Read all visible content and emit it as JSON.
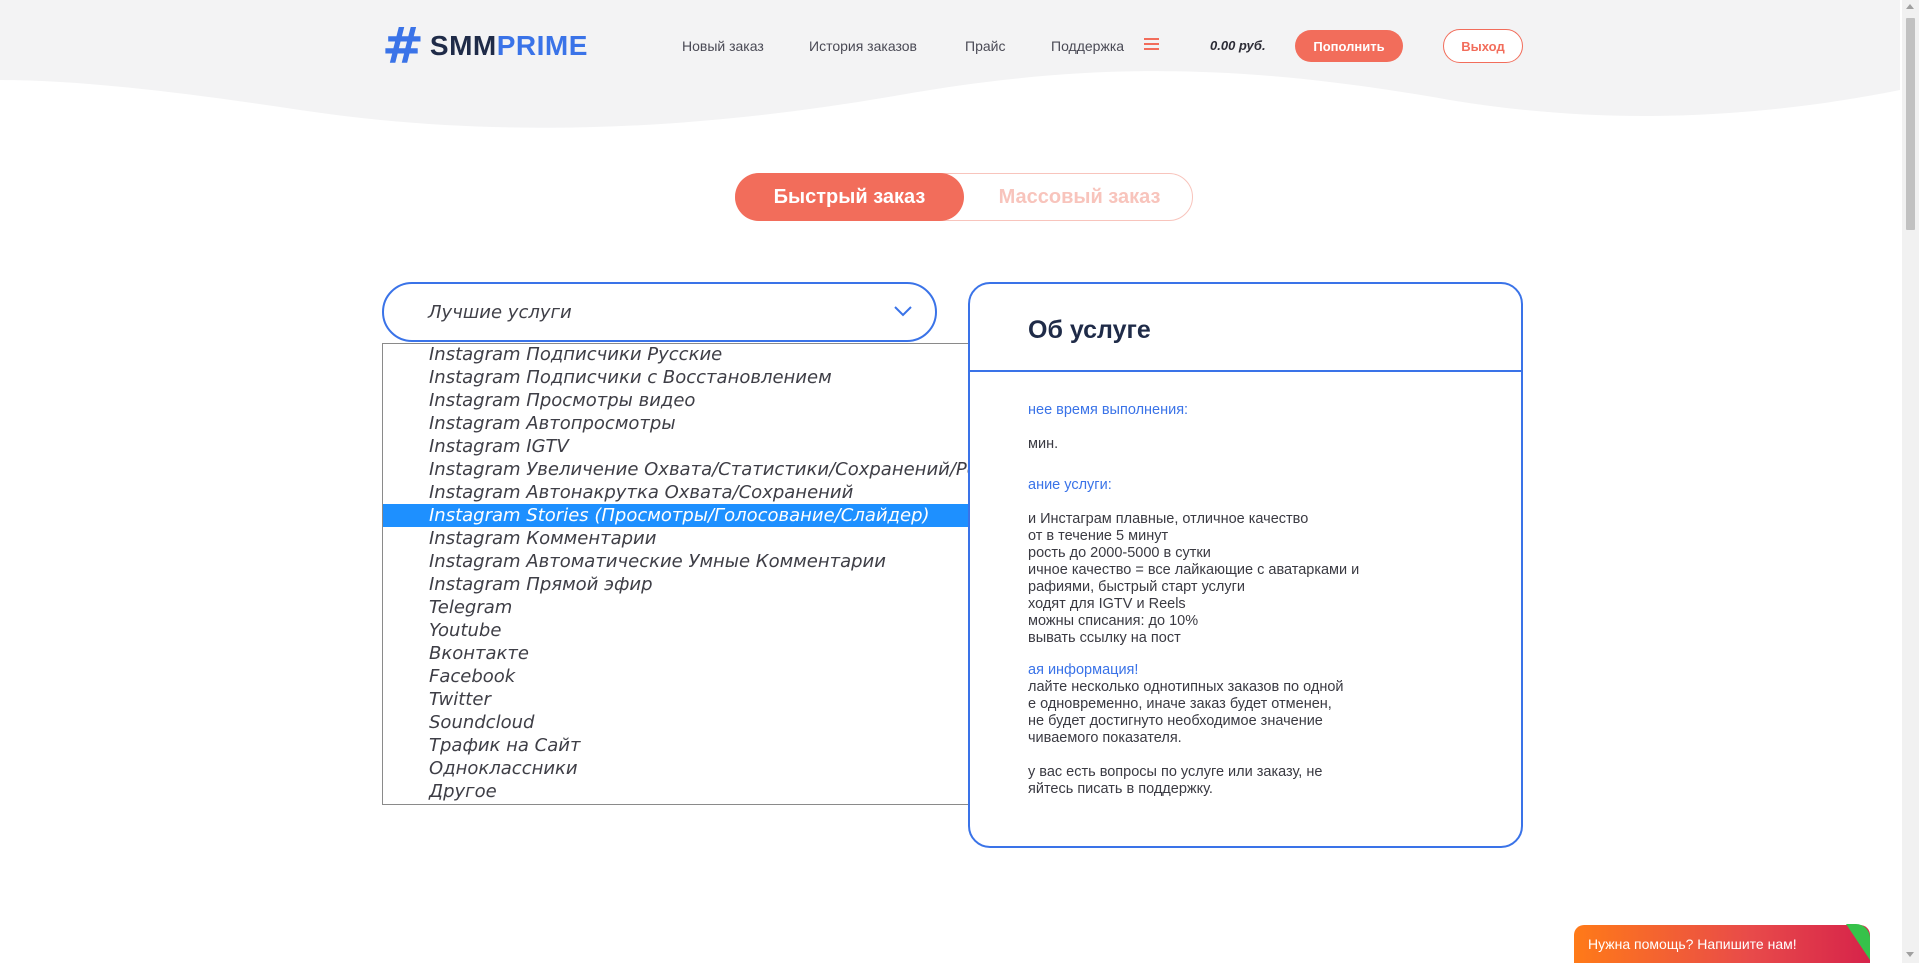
{
  "header": {
    "logo_smm": "SMM",
    "logo_prime": "PRIME",
    "nav": [
      "Новый заказ",
      "История заказов",
      "Прайс",
      "Поддержка"
    ],
    "balance": "0.00 руб.",
    "topup_label": "Пополнить",
    "exit_label": "Выход"
  },
  "tabs": {
    "quick": "Быстрый заказ",
    "mass": "Массовый заказ"
  },
  "select": {
    "value": "Лучшие услуги",
    "options": [
      "Instagram Подписчики Русские",
      "Instagram Подписчики с Восстановлением",
      "Instagram Просмотры видео",
      "Instagram Автопросмотры",
      "Instagram IGTV",
      "Instagram Увеличение Охвата/Статистики/Сохранений/Репостов",
      "Instagram Автонакрутка Охвата/Сохранений",
      "Instagram Stories (Просмотры/Голосование/Слайдер)",
      "Instagram Комментарии",
      "Instagram Автоматические Умные Комментарии",
      "Instagram Прямой эфир",
      "Telegram",
      "Youtube",
      "Вконтакте",
      "Facebook",
      "Twitter",
      "Soundcloud",
      "Трафик на Сайт",
      "Одноклассники",
      "Другое"
    ],
    "selected_option": "Instagram Stories (Просмотры/Голосование/Слайдер)"
  },
  "about": {
    "title": "Об услуге",
    "time_label": "нее время выполнения:",
    "time_value": "мин.",
    "desc_label": "ание услуги:",
    "desc_lines": [
      "и Инстаграм плавные, отличное качество",
      "от в течение 5 минут",
      "рость до 2000-5000 в сутки",
      "ичное качество = все лайкающие с аватарками и",
      "рафиями, быстрый старт услуги",
      "ходят для IGTV и Reels",
      "можны списания: до 10%",
      "вывать ссылку на пост"
    ],
    "info_label": "ая информация!",
    "info_lines": [
      "лайте несколько однотипных заказов по одной",
      "е одновременно, иначе заказ будет отменен,",
      "не будет достигнуто необходимое значение",
      "чиваемого показателя.",
      "",
      "у вас есть вопросы по услуге или заказу, не",
      "яйтесь писать в поддержку."
    ]
  },
  "help_widget": {
    "label": "Нужна помощь? Напишите нам!"
  },
  "colors": {
    "accent": "#f26d5b",
    "brand_blue": "#3a73e8",
    "selected_option": "#1e90ff"
  }
}
